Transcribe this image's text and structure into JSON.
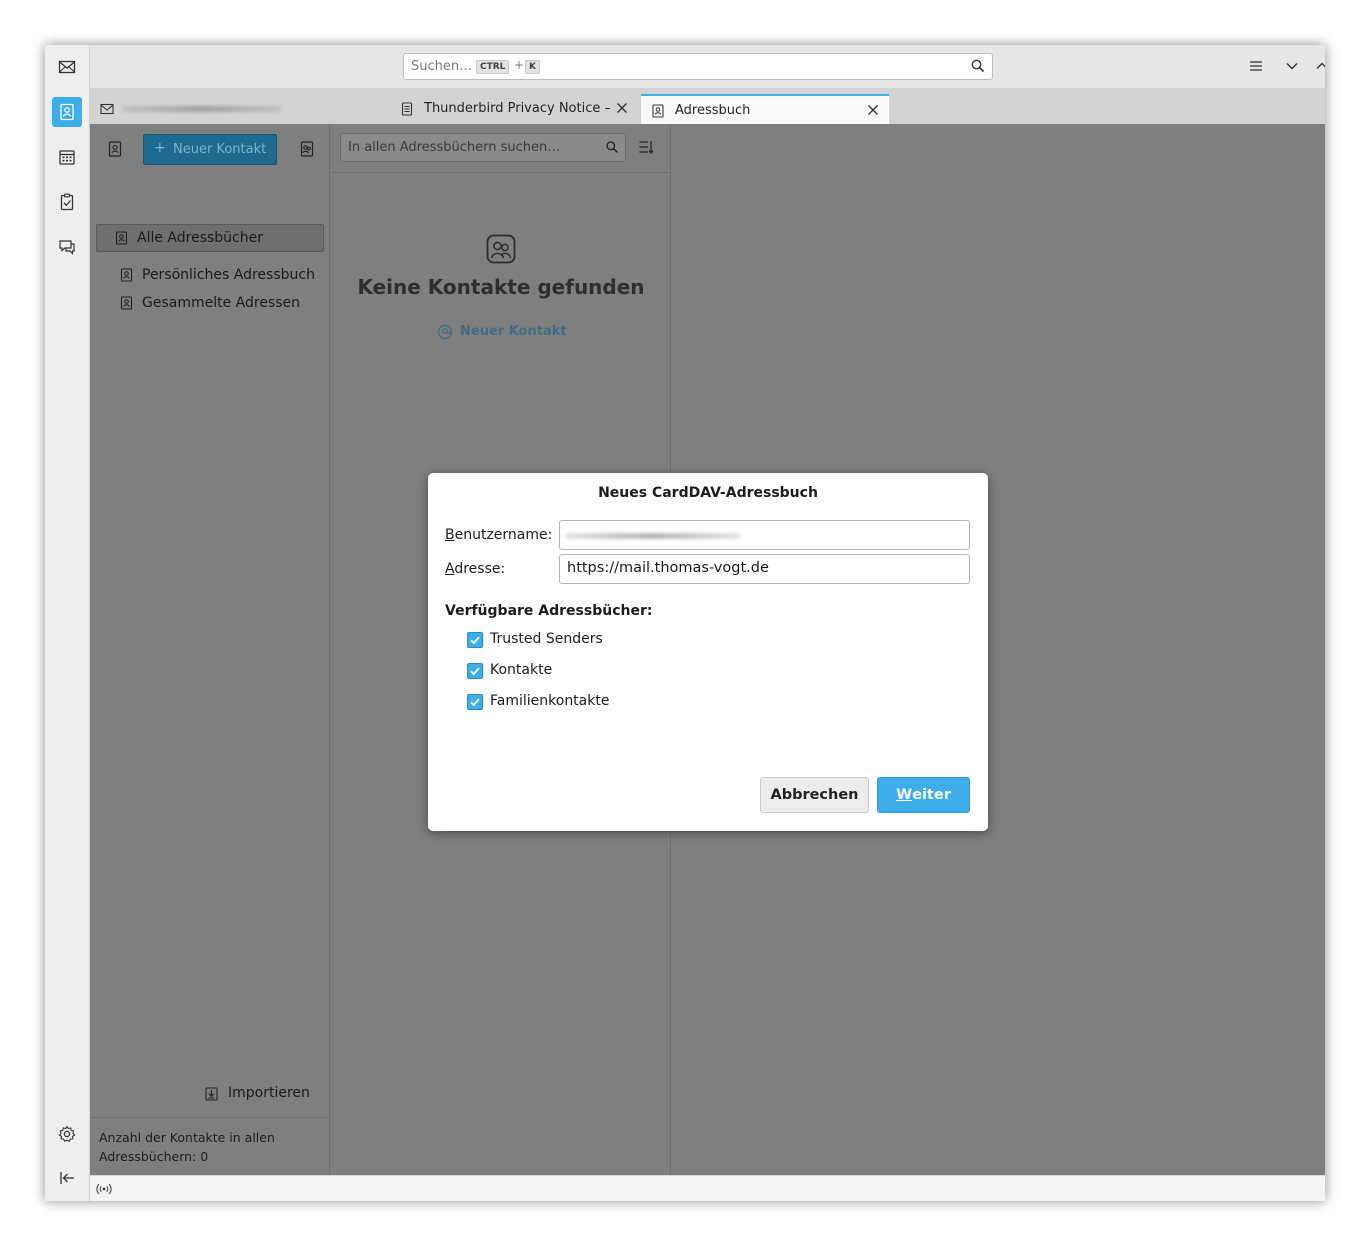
{
  "global_search": {
    "placeholder": "Suchen…",
    "shortcut_mod": "CTRL",
    "shortcut_plus": "+",
    "shortcut_key": "K"
  },
  "tabs": [
    {
      "label": "",
      "icon": "mail-icon",
      "blurred": true
    },
    {
      "label": "Thunderbird Privacy Notice —",
      "icon": "document-icon"
    },
    {
      "label": "Adressbuch",
      "icon": "address-book-icon",
      "active": true
    }
  ],
  "toolbar": {
    "new_contact_label": "Neuer Kontakt",
    "new_contact_plus": "+"
  },
  "address_books": [
    {
      "label": "Alle Adressbücher",
      "selected": true
    },
    {
      "label": "Persönliches Adressbuch"
    },
    {
      "label": "Gesammelte Adressen"
    }
  ],
  "import_label": "Importieren",
  "footer_text_line1": "Anzahl der Kontakte in allen",
  "footer_text_line2": "Adressbüchern: 0",
  "list": {
    "search_placeholder": "In allen Adressbüchern suchen…",
    "empty_title": "Keine Kontakte gefunden",
    "empty_link": "Neuer Kontakt"
  },
  "dialog": {
    "title": "Neues CardDAV-Adressbuch",
    "username_label_first": "B",
    "username_label_rest": "enutzername:",
    "username_value": "",
    "address_label_first": "A",
    "address_label_rest": "dresse:",
    "address_value": "https://mail.thomas-vogt.de",
    "available_label": "Verfügbare Adressbücher:",
    "books": [
      {
        "label": "Trusted Senders",
        "checked": true
      },
      {
        "label": "Kontakte",
        "checked": true
      },
      {
        "label": "Familienkontakte",
        "checked": true
      }
    ],
    "cancel_label": "Abbrechen",
    "next_label_first": "W",
    "next_label_rest": "eiter"
  },
  "colors": {
    "accent": "#3daee9",
    "overlay": "#7f7f7f"
  }
}
